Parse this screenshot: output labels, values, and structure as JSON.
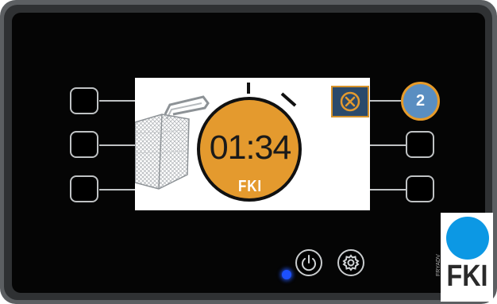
{
  "display": {
    "timer": "01:34",
    "timer_brand": "FKI",
    "position_badge": "2"
  },
  "logo": {
    "text": "FKI",
    "side_text": "FRYADV"
  },
  "colors": {
    "timer_orange": "#e49a2e",
    "close_blue": "#2b4a6b",
    "badge_blue": "#5a8ec1",
    "led_blue": "#1c50ff",
    "logo_blue": "#0c98e4"
  },
  "icons": {
    "close": "close-circle-icon",
    "power": "power-icon",
    "settings": "gear-icon"
  }
}
